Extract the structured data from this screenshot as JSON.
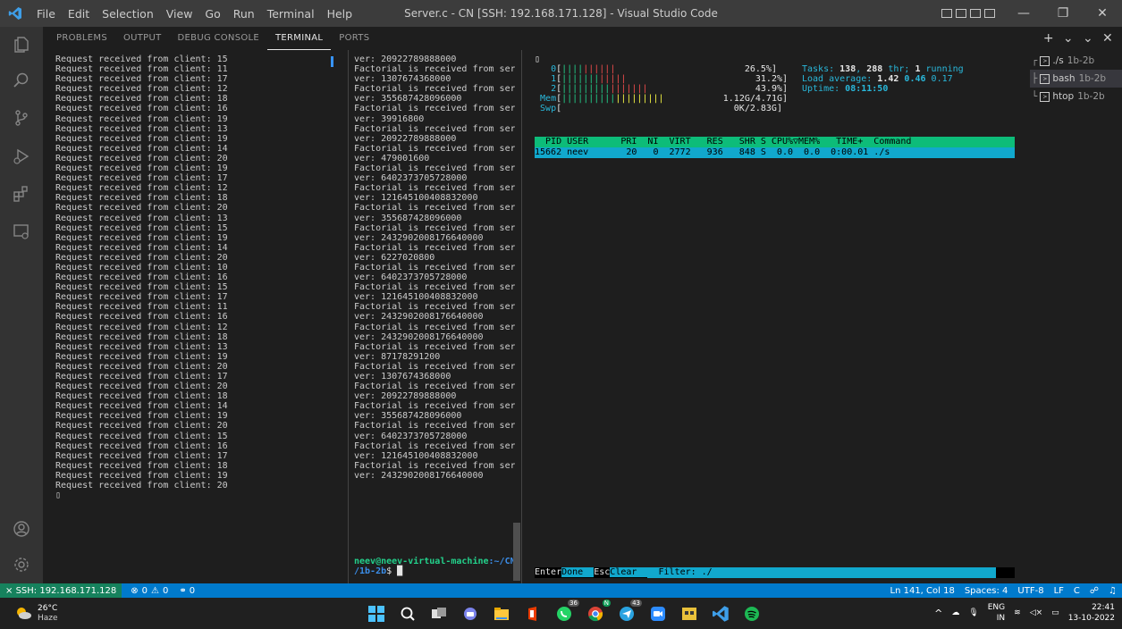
{
  "window": {
    "title": "Server.c - CN [SSH: 192.168.171.128] - Visual Studio Code",
    "menu": [
      "File",
      "Edit",
      "Selection",
      "View",
      "Go",
      "Run",
      "Terminal",
      "Help"
    ],
    "controls": {
      "minimize": "—",
      "restore": "❐",
      "close": "✕"
    }
  },
  "panel": {
    "tabs": [
      "PROBLEMS",
      "OUTPUT",
      "DEBUG CONSOLE",
      "TERMINAL",
      "PORTS"
    ],
    "active_tab": "TERMINAL",
    "actions": {
      "add": "+",
      "dropdown": "⌄",
      "chevron": "⌄",
      "close": "✕"
    }
  },
  "terminal1": {
    "lines": [
      "Request received from client: 15",
      "Request received from client: 11",
      "Request received from client: 17",
      "Request received from client: 12",
      "Request received from client: 18",
      "Request received from client: 16",
      "Request received from client: 19",
      "Request received from client: 13",
      "Request received from client: 19",
      "Request received from client: 14",
      "Request received from client: 20",
      "Request received from client: 19",
      "Request received from client: 17",
      "Request received from client: 12",
      "Request received from client: 18",
      "Request received from client: 20",
      "Request received from client: 13",
      "Request received from client: 15",
      "Request received from client: 19",
      "Request received from client: 14",
      "Request received from client: 20",
      "Request received from client: 10",
      "Request received from client: 16",
      "Request received from client: 15",
      "Request received from client: 17",
      "Request received from client: 11",
      "Request received from client: 16",
      "Request received from client: 12",
      "Request received from client: 18",
      "Request received from client: 13",
      "Request received from client: 19",
      "Request received from client: 20",
      "Request received from client: 17",
      "Request received from client: 20",
      "Request received from client: 18",
      "Request received from client: 14",
      "Request received from client: 19",
      "Request received from client: 20",
      "Request received from client: 15",
      "Request received from client: 16",
      "Request received from client: 17",
      "Request received from client: 18",
      "Request received from client: 19",
      "Request received from client: 20",
      "▯"
    ]
  },
  "terminal2": {
    "lines": [
      "ver: 20922789888000",
      "Factorial is received from ser",
      "ver: 1307674368000",
      "Factorial is received from ser",
      "ver: 355687428096000",
      "Factorial is received from ser",
      "ver: 39916800",
      "Factorial is received from ser",
      "ver: 20922789888000",
      "Factorial is received from ser",
      "ver: 479001600",
      "Factorial is received from ser",
      "ver: 6402373705728000",
      "Factorial is received from ser",
      "ver: 121645100408832000",
      "Factorial is received from ser",
      "ver: 355687428096000",
      "Factorial is received from ser",
      "ver: 2432902008176640000",
      "Factorial is received from ser",
      "ver: 6227020800",
      "Factorial is received from ser",
      "ver: 6402373705728000",
      "Factorial is received from ser",
      "ver: 121645100408832000",
      "Factorial is received from ser",
      "ver: 2432902008176640000",
      "Factorial is received from ser",
      "ver: 2432902008176640000",
      "Factorial is received from ser",
      "ver: 87178291200",
      "Factorial is received from ser",
      "ver: 1307674368000",
      "Factorial is received from ser",
      "ver: 20922789888000",
      "Factorial is received from ser",
      "ver: 355687428096000",
      "Factorial is received from ser",
      "ver: 6402373705728000",
      "Factorial is received from ser",
      "ver: 121645100408832000",
      "Factorial is received from ser",
      "ver: 2432902008176640000"
    ],
    "prompt_user": "neev@neev-virtual-machine",
    "prompt_path1": ":~/CN",
    "prompt_path2": "/1b-2b",
    "prompt_symbol": "$ "
  },
  "htop": {
    "cpu": [
      {
        "label": "0",
        "bar_green": "||||",
        "bar_red": "||||||",
        "pct": "26.5%"
      },
      {
        "label": "1",
        "bar_green": "|||||||",
        "bar_red": "|||||",
        "pct": "31.2%"
      },
      {
        "label": "2",
        "bar_green": "|||||||||",
        "bar_red": "|||||||",
        "pct": "43.9%"
      }
    ],
    "mem": {
      "label": "Mem",
      "bar_green": "||||||||||",
      "bar_yellow": "|||||||||",
      "value": "1.12G/4.71G"
    },
    "swp": {
      "label": "Swp",
      "value": "0K/2.83G"
    },
    "tasks_label": "Tasks: ",
    "tasks": "138",
    "sep": ", ",
    "thr": "288",
    "thr_label": " thr; ",
    "running": "1",
    "running_label": " running",
    "load_label": "Load average: ",
    "load1": "1.42",
    "load2": "0.46",
    "load3": "0.17",
    "uptime_label": "Uptime: ",
    "uptime": "08:11:50",
    "header": "  PID USER      PRI  NI  VIRT   RES   SHR S CPU%▽MEM%   TIME+  Command",
    "row": "15662 neev       20   0  2772   936   848 S  0.0  0.0  0:00.01 ./s",
    "footer": {
      "k1": "Enter",
      "v1": "Done  ",
      "k2": "Esc",
      "v2": "Clear  ",
      "filter": "  Filter: ./"
    }
  },
  "terminal_list": [
    {
      "name": "./s",
      "tag": "1b-2b"
    },
    {
      "name": "bash",
      "tag": "1b-2b"
    },
    {
      "name": "htop",
      "tag": "1b-2b"
    }
  ],
  "statusbar": {
    "remote": "SSH: 192.168.171.128",
    "errors": "0",
    "warnings": "0",
    "ports": "0",
    "position": "Ln 141, Col 18",
    "spaces": "Spaces: 4",
    "encoding": "UTF-8",
    "eol": "LF",
    "lang": "C"
  },
  "taskbar": {
    "temp": "26°C",
    "weather": "Haze",
    "badge1": "36",
    "badge2": "N",
    "badge3": "43",
    "lang1": "ENG",
    "lang2": "IN",
    "time": "22:41",
    "date": "13-10-2022"
  },
  "colors": {
    "accent": "#007acc",
    "remote": "#16825d",
    "htop_header": "#0dbc79",
    "htop_row": "#11a8cd"
  }
}
